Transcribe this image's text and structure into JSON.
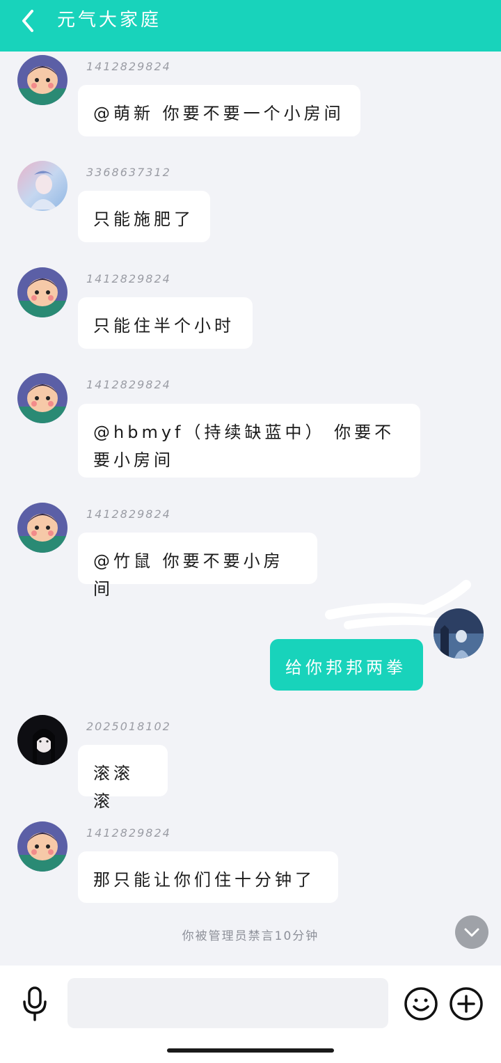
{
  "header": {
    "title": "元气大家庭"
  },
  "messages": [
    {
      "sender": "1412829824",
      "text": "@萌新 你要不要一个小房间",
      "avatar": "cartoon-prince-avatar"
    },
    {
      "sender": "3368637312",
      "text": "只能施肥了",
      "avatar": "anime-girl-avatar"
    },
    {
      "sender": "1412829824",
      "text": "只能住半个小时",
      "avatar": "cartoon-prince-avatar"
    },
    {
      "sender": "1412829824",
      "text": "@hbmyf（持续缺蓝中） 你要不要小房间",
      "avatar": "cartoon-prince-avatar"
    },
    {
      "sender": "1412829824",
      "text": "@竹鼠 你要不要小房间",
      "avatar": "cartoon-prince-avatar"
    },
    {
      "sender": "",
      "text": "给你邦邦两拳",
      "avatar": "self-avatar",
      "mine": true
    },
    {
      "sender": "2025018102",
      "text": "滚滚滚",
      "avatar": "dark-hair-girl-avatar"
    },
    {
      "sender": "1412829824",
      "text": "那只能让你们住十分钟了",
      "avatar": "cartoon-prince-avatar"
    }
  ],
  "system_note": "你被管理员禁言10分钟",
  "composer": {
    "value": "",
    "placeholder": ""
  },
  "colors": {
    "accent": "#18d3bb",
    "background": "#f2f3f7"
  },
  "icons": [
    "back-arrow-icon",
    "microphone-icon",
    "emoji-icon",
    "plus-icon",
    "chevron-down-icon"
  ]
}
